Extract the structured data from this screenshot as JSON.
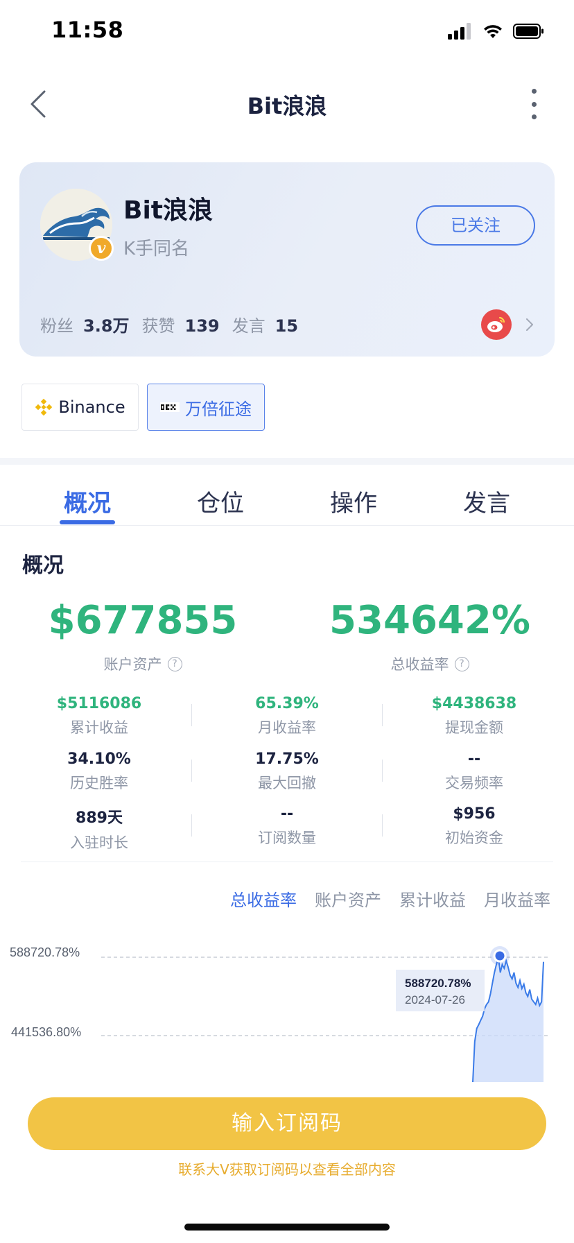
{
  "status_bar": {
    "time": "11:58"
  },
  "nav": {
    "title": "Bit浪浪"
  },
  "profile": {
    "name": "Bit浪浪",
    "subtitle": "K手同名",
    "follow_label": "已关注",
    "verified_badge": "v",
    "stats": [
      {
        "label": "粉丝",
        "value": "3.8万"
      },
      {
        "label": "获赞",
        "value": "139"
      },
      {
        "label": "发言",
        "value": "15"
      }
    ]
  },
  "exchanges": [
    {
      "label": "Binance",
      "icon": "binance-icon",
      "selected": false
    },
    {
      "label": "万倍征途",
      "icon": "okx-icon",
      "selected": true
    }
  ],
  "tabs": [
    {
      "label": "概况",
      "active": true
    },
    {
      "label": "仓位",
      "active": false
    },
    {
      "label": "操作",
      "active": false
    },
    {
      "label": "发言",
      "active": false
    }
  ],
  "overview": {
    "title": "概况",
    "account_assets": {
      "value": "$677855",
      "label": "账户资产"
    },
    "total_return": {
      "value": "534642%",
      "label": "总收益率"
    },
    "stats": [
      {
        "value": "$5116086",
        "label": "累计收益"
      },
      {
        "value": "65.39%",
        "label": "月收益率"
      },
      {
        "value": "$4438638",
        "label": "提现金额"
      },
      {
        "value": "34.10%",
        "label": "历史胜率"
      },
      {
        "value": "17.75%",
        "label": "最大回撤"
      },
      {
        "value": "--",
        "label": "交易频率"
      },
      {
        "value": "889天",
        "label": "入驻时长"
      },
      {
        "value": "--",
        "label": "订阅数量"
      },
      {
        "value": "$956",
        "label": "初始资金"
      }
    ]
  },
  "chart_tabs": [
    {
      "label": "总收益率",
      "active": true
    },
    {
      "label": "账户资产",
      "active": false
    },
    {
      "label": "累计收益",
      "active": false
    },
    {
      "label": "月收益率",
      "active": false
    }
  ],
  "chart_data": {
    "type": "area",
    "ytick_labels": [
      "588720.78%",
      "441536.80%"
    ],
    "y_ticks": [
      588720.78,
      441536.8
    ],
    "ylim": [
      341000,
      588720.78
    ],
    "tooltip": {
      "value": "588720.78%",
      "date": "2024-07-26"
    },
    "series": [
      {
        "values": [
          341000,
          430000,
          455000,
          462000,
          470000,
          478000,
          492000,
          500000,
          505000,
          520000,
          540000,
          560000,
          575000,
          588720.78,
          560000,
          575000,
          568000,
          582000,
          570000,
          555000,
          548000,
          560000,
          540000,
          532000,
          545000,
          530000,
          538000,
          522000,
          515000,
          528000,
          510000,
          505000,
          500000,
          512000,
          498000,
          505000,
          580000
        ]
      }
    ]
  },
  "colors": {
    "accent": "#3a6be4",
    "positive": "#2fb47d",
    "cta": "#f2c445",
    "hint": "#e7ac2f"
  },
  "cta": {
    "button_label": "输入订阅码",
    "hint": "联系大V获取订阅码以查看全部内容"
  }
}
